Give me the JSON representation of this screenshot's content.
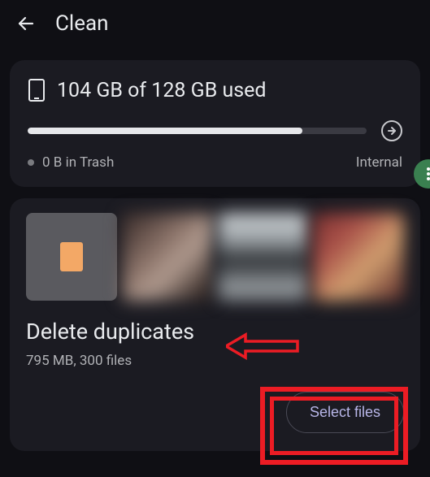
{
  "header": {
    "title": "Clean"
  },
  "storage": {
    "used_text": "104 GB of 128 GB used",
    "progress_percent": 81,
    "trash_text": "0 B in Trash",
    "location_label": "Internal"
  },
  "duplicates": {
    "title": "Delete duplicates",
    "subtitle": "795 MB, 300 files",
    "thumbnails": [
      {
        "kind": "archive-icon"
      },
      {
        "kind": "photo-blur"
      },
      {
        "kind": "photo-blur"
      },
      {
        "kind": "photo-blur"
      }
    ],
    "select_button": "Select files"
  },
  "annotation": {
    "arrow_color": "#ec1c24",
    "box_color": "#ec1c24"
  }
}
